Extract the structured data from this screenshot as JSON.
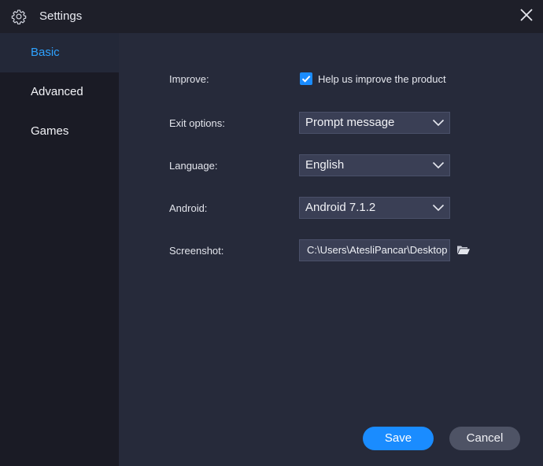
{
  "window": {
    "title": "Settings"
  },
  "sidebar": {
    "items": [
      {
        "label": "Basic",
        "active": true
      },
      {
        "label": "Advanced",
        "active": false
      },
      {
        "label": "Games",
        "active": false
      }
    ]
  },
  "form": {
    "improve": {
      "label": "Improve:",
      "checkbox_label": "Help us improve the product",
      "checked": true
    },
    "exit_options": {
      "label": "Exit options:",
      "value": "Prompt message"
    },
    "language": {
      "label": "Language:",
      "value": "English"
    },
    "android": {
      "label": "Android:",
      "value": "Android 7.1.2"
    },
    "screenshot": {
      "label": "Screenshot:",
      "value": "C:\\Users\\AtesliPancar\\Desktop"
    }
  },
  "actions": {
    "save_label": "Save",
    "cancel_label": "Cancel"
  },
  "colors": {
    "accent": "#1a8cff",
    "active_nav_text": "#2ea2ff",
    "background": "#262a3a",
    "sidebar": "#1a1b25"
  },
  "icons": {
    "title": "gear-icon",
    "close": "close-icon",
    "dropdown": "chevron-down-icon",
    "browse": "folder-open-icon",
    "checkbox": "checkmark-icon"
  }
}
